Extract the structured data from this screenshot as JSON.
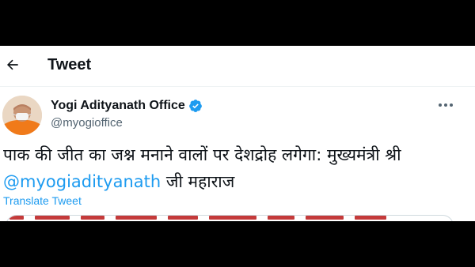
{
  "header": {
    "back_icon": "arrow-left-icon",
    "title": "Tweet"
  },
  "tweet": {
    "display_name": "Yogi Adityanath Office",
    "verified_icon": "verified-badge-icon",
    "handle": "@myogioffice",
    "more_icon": "more-horizontal-icon",
    "text_main": "पाक की जीत का जश्न मनाने वालों पर देशद्रोह लगेगा: मुख्यमंत्री श्री",
    "mention": "@myogiadityanath",
    "text_tail": " जी महाराज",
    "translate_label": "Translate Tweet"
  },
  "colors": {
    "accent": "#1d9bf0",
    "text_primary": "#0f1419",
    "text_secondary": "#536471"
  }
}
